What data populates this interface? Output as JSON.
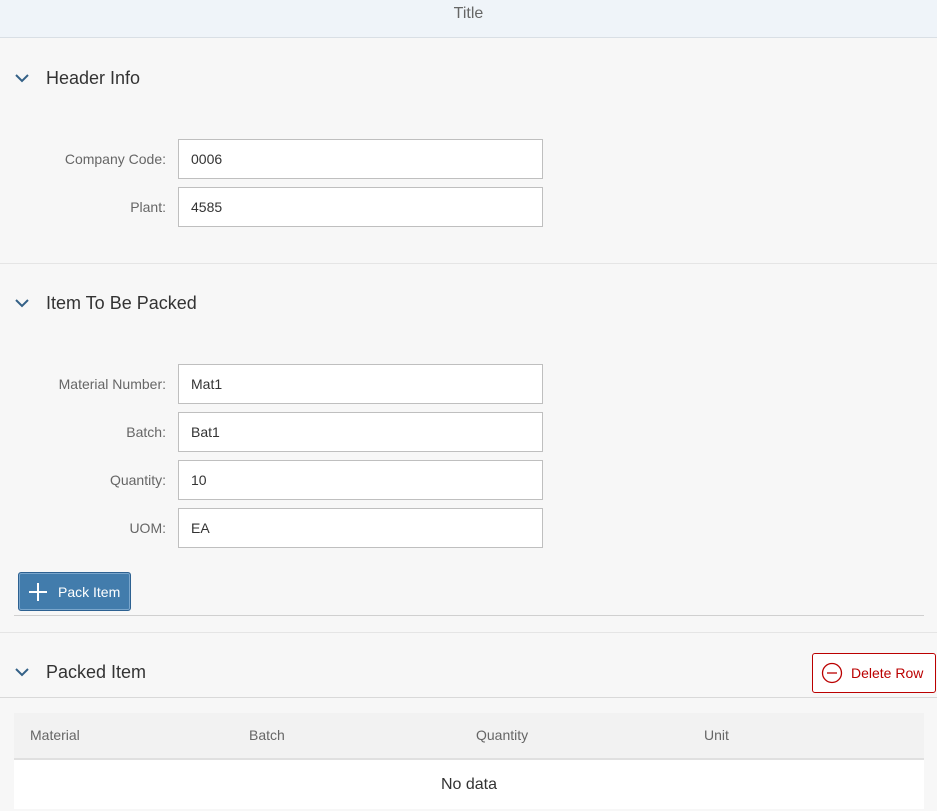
{
  "page": {
    "title": "Title"
  },
  "sections": {
    "header_info": {
      "title": "Header Info",
      "fields": {
        "company_code": {
          "label": "Company Code:",
          "value": "0006"
        },
        "plant": {
          "label": "Plant:",
          "value": "4585"
        }
      }
    },
    "item_to_pack": {
      "title": "Item To Be Packed",
      "fields": {
        "material_number": {
          "label": "Material Number:",
          "value": "Mat1"
        },
        "batch": {
          "label": "Batch:",
          "value": "Bat1"
        },
        "quantity": {
          "label": "Quantity:",
          "value": "10"
        },
        "uom": {
          "label": "UOM:",
          "value": "EA"
        }
      },
      "pack_button": {
        "label": "Pack Item",
        "icon": "plus-icon"
      }
    },
    "packed_item": {
      "title": "Packed Item",
      "delete_button": {
        "label": "Delete Row",
        "icon": "minus-circle-icon"
      },
      "table": {
        "columns": [
          "Material",
          "Batch",
          "Quantity",
          "Unit"
        ],
        "empty_text": "No data"
      }
    }
  },
  "colors": {
    "accent": "#427cac",
    "danger": "#bb0000",
    "chevron": "#346187"
  }
}
